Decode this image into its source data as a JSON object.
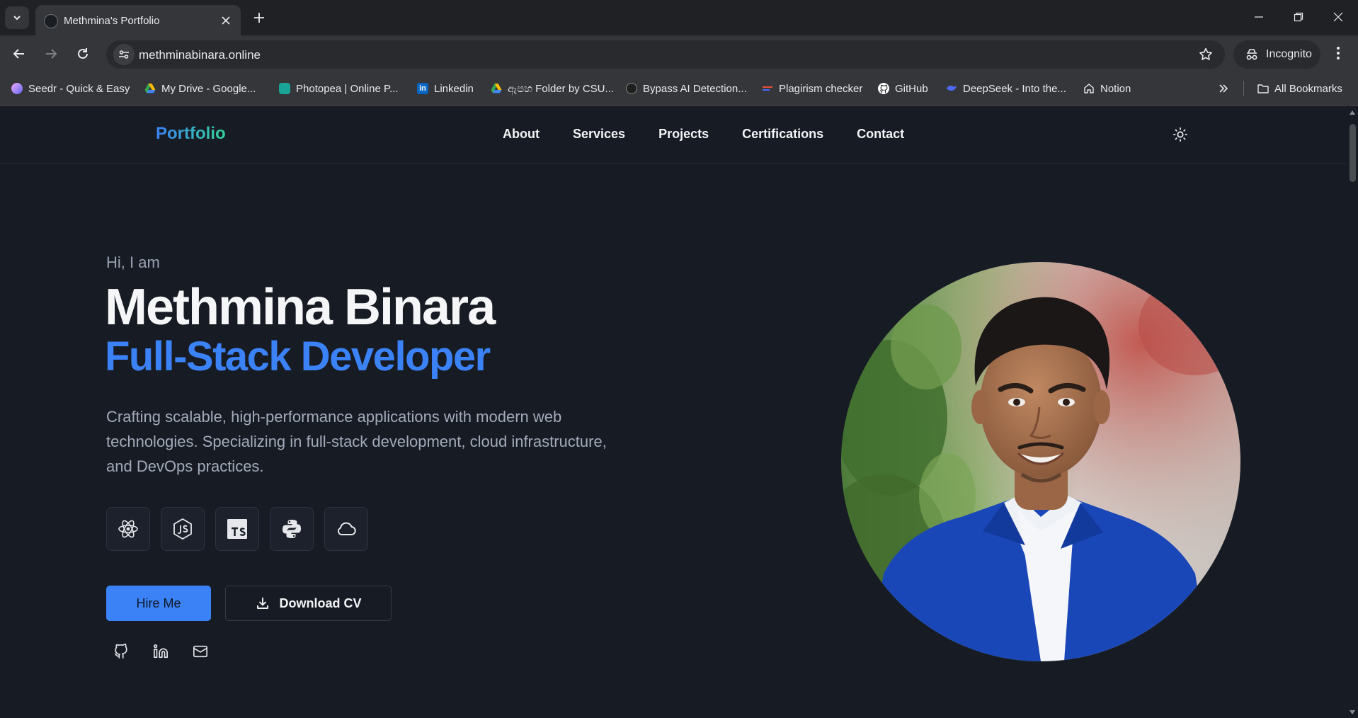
{
  "browser": {
    "tab_title": "Methmina's Portfolio",
    "url": "methminabinara.online",
    "incognito_label": "Incognito",
    "bookmarks": [
      {
        "label": "Seedr - Quick & Easy",
        "color": "#a78bfa"
      },
      {
        "label": "My Drive - Google...",
        "color": "#fbbc04"
      },
      {
        "label": "Photopea | Online P...",
        "color": "#18a497"
      },
      {
        "label": "Linkedin",
        "color": "#0a66c2"
      },
      {
        "label": "ඇපහ Folder by CSU...",
        "color": "#34a853"
      },
      {
        "label": "Bypass AI Detection...",
        "color": "#1f1f1f"
      },
      {
        "label": "Plagirism checker",
        "color": "#e94f37"
      },
      {
        "label": "GitHub",
        "color": "#ffffff"
      },
      {
        "label": "DeepSeek - Into the...",
        "color": "#4d6bfe"
      },
      {
        "label": "Notion",
        "color": "#e8eaed"
      }
    ],
    "all_bookmarks_label": "All Bookmarks"
  },
  "site": {
    "logo": "Portfolio",
    "nav": [
      "About",
      "Services",
      "Projects",
      "Certifications",
      "Contact"
    ],
    "hero": {
      "greeting": "Hi, I am",
      "name": "Methmina Binara",
      "role": "Full-Stack Developer",
      "description": "Crafting scalable, high-performance applications with modern web technologies. Specializing in full-stack development, cloud infrastructure, and DevOps practices.",
      "tech_icons": [
        "react-icon",
        "nodejs-icon",
        "typescript-icon",
        "python-icon",
        "cloud-icon"
      ],
      "hire_label": "Hire Me",
      "cv_label": "Download CV",
      "social_icons": [
        "github-icon",
        "linkedin-icon",
        "mail-icon"
      ]
    }
  },
  "colors": {
    "accent": "#3b82f6",
    "background": "#171b24",
    "logo_gradient_end": "#34d399"
  }
}
